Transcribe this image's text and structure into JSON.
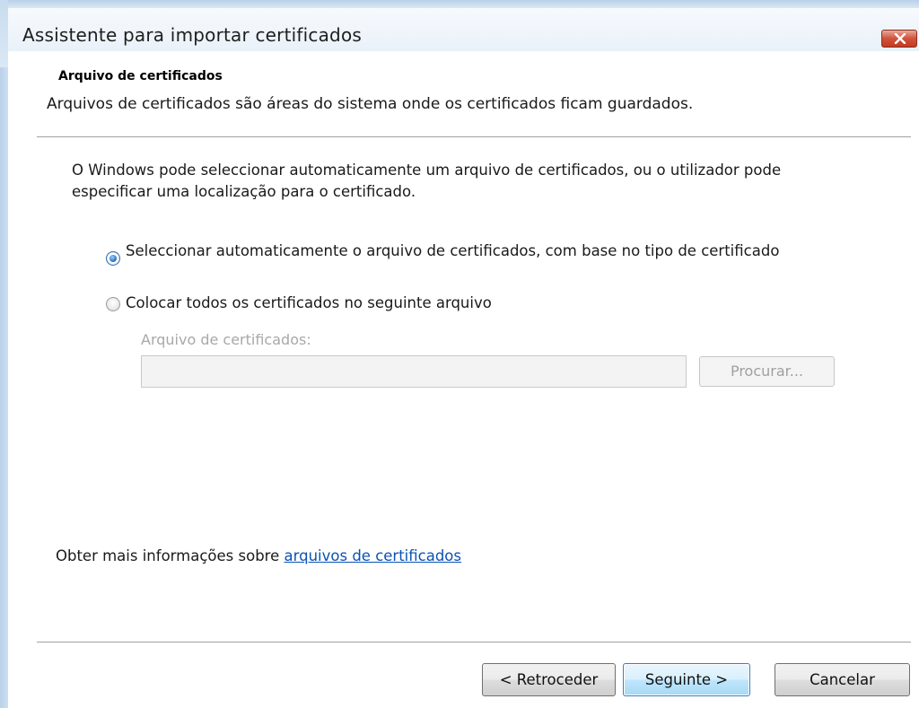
{
  "window": {
    "title": "Assistente para importar certificados"
  },
  "header": {
    "title": "Arquivo de certificados",
    "description": "Arquivos de certificados são áreas do sistema onde os certificados ficam guardados."
  },
  "body": {
    "intro": "O Windows pode seleccionar automaticamente um arquivo de certificados, ou o utilizador pode especificar uma localização para o certificado.",
    "options": [
      {
        "label": "Seleccionar automaticamente o arquivo de certificados, com base no tipo de certificado",
        "selected": true
      },
      {
        "label": "Colocar todos os certificados no seguinte arquivo",
        "selected": false
      }
    ],
    "store_label": "Arquivo de certificados:",
    "store_value": "",
    "browse_label": "Procurar..."
  },
  "footer": {
    "more_info_prefix": "Obter mais informações sobre ",
    "more_info_link": "arquivos de certificados",
    "back_label": "< Retroceder",
    "next_label": "Seguinte >",
    "cancel_label": "Cancelar"
  },
  "icons": {
    "close": "close-icon",
    "radio_selected": "radio-selected-icon",
    "radio_unselected": "radio-unselected-icon"
  },
  "colors": {
    "close_button": "#c23b22",
    "link": "#0a52b5",
    "default_button_border": "#3c7fb1",
    "disabled_text": "#a8a8a8"
  }
}
